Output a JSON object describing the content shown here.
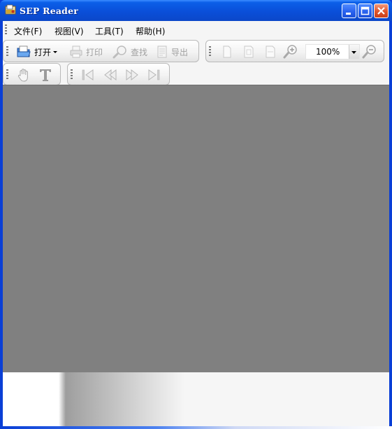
{
  "window": {
    "title": "SEP Reader"
  },
  "menubar": {
    "items": [
      {
        "label": "文件(F)"
      },
      {
        "label": "视图(V)"
      },
      {
        "label": "工具(T)"
      },
      {
        "label": "帮助(H)"
      }
    ]
  },
  "toolbar": {
    "open_label": "打开",
    "print_label": "打印",
    "find_label": "查找",
    "export_label": "导出",
    "zoom_value": "100%"
  },
  "icons": {
    "open": "folder-open-icon",
    "print": "printer-icon",
    "find": "magnifier-icon",
    "export": "export-document-icon",
    "zoom_in": "zoom-in-icon",
    "zoom_out": "zoom-out-icon",
    "hand": "hand-tool-icon",
    "text": "text-select-icon",
    "first": "first-page-icon",
    "prev": "previous-page-icon",
    "next": "next-page-icon",
    "last": "last-page-icon"
  },
  "colors": {
    "titlebar": "#0a4fd9",
    "doc_background": "#808080",
    "toolbar_background": "#f5f5f5"
  }
}
